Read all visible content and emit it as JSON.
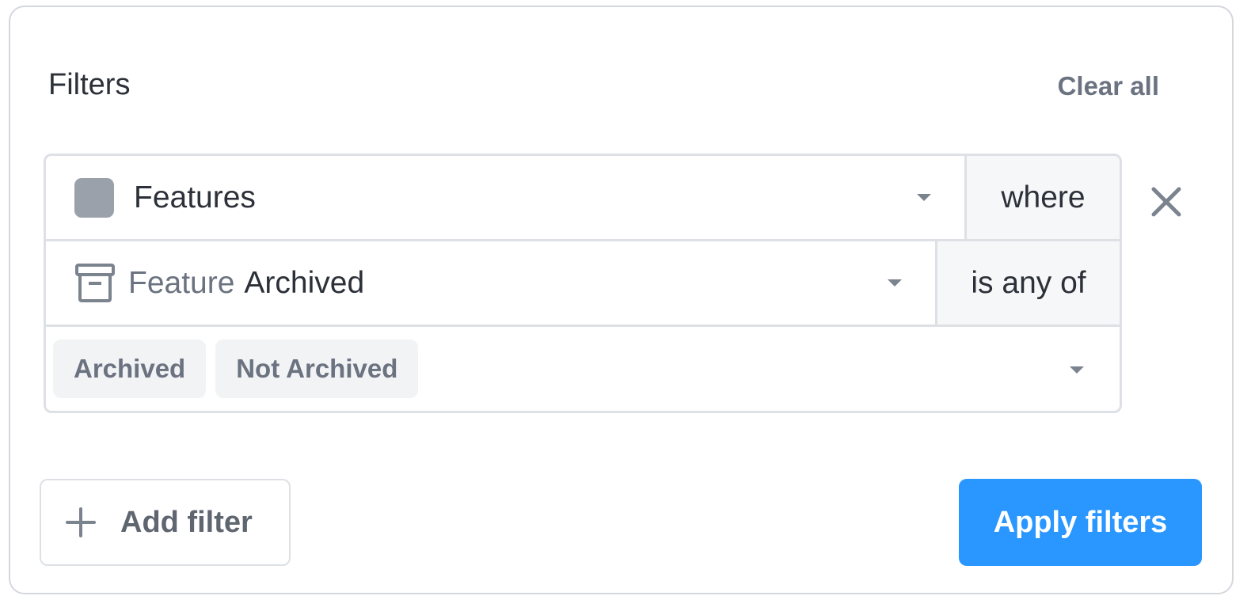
{
  "header": {
    "title": "Filters",
    "clear_all_label": "Clear all"
  },
  "filter": {
    "object": {
      "label": "Features",
      "icon": "square-icon",
      "operator": "where"
    },
    "attribute": {
      "prefix": "Feature",
      "label": "Archived",
      "icon": "archive-icon",
      "operator": "is any of"
    },
    "values": [
      "Archived",
      "Not Archived"
    ],
    "remove_icon": "close-icon"
  },
  "footer": {
    "add_filter_label": "Add filter",
    "add_icon": "plus-icon",
    "apply_label": "Apply filters"
  },
  "colors": {
    "accent": "#2997ff",
    "text": "#2c3038",
    "muted": "#6b7280",
    "border": "#dde1e6",
    "chip_bg": "#f1f3f5",
    "icon_gray": "#9aa1ab"
  }
}
